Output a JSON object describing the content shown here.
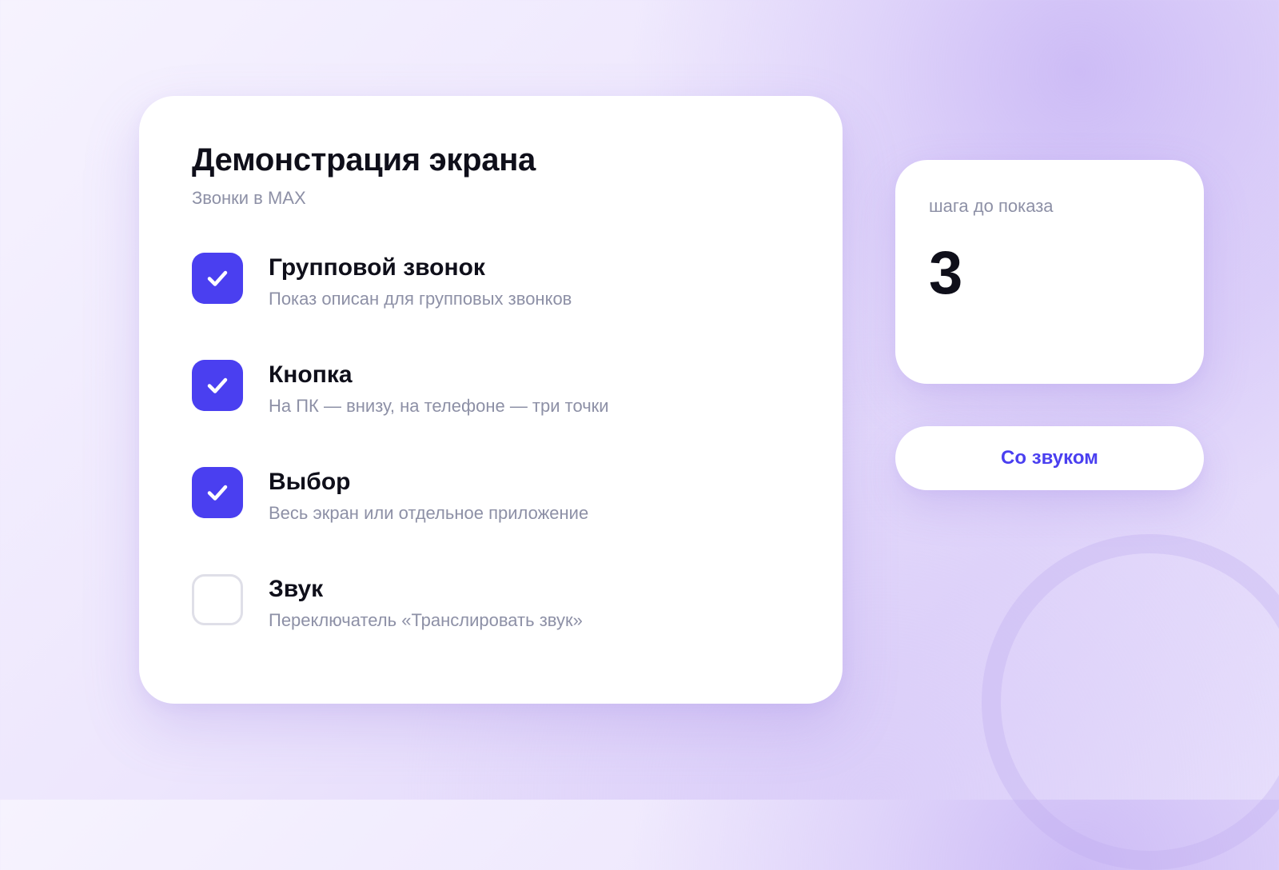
{
  "card": {
    "title": "Демонстрация экрана",
    "subtitle": "Звонки в MAX",
    "items": [
      {
        "title": "Групповой звонок",
        "description": "Показ описан для групповых звонков",
        "checked": true
      },
      {
        "title": "Кнопка",
        "description": "На ПК — внизу, на телефоне — три точки",
        "checked": true
      },
      {
        "title": "Выбор",
        "description": "Весь экран или отдельное приложение",
        "checked": true
      },
      {
        "title": "Звук",
        "description": "Переключатель «Транслировать звук»",
        "checked": false
      }
    ]
  },
  "steps": {
    "label": "шага до показа",
    "count": "3"
  },
  "sound_button": {
    "label": "Со звуком"
  },
  "colors": {
    "accent": "#4a3ff0",
    "title_text": "#0f0f1a",
    "muted_text": "#8d90a6",
    "card_background": "#ffffff",
    "unchecked_border": "#dfdfe8"
  },
  "icons": {
    "checkbox_checked": "checkmark-icon"
  }
}
